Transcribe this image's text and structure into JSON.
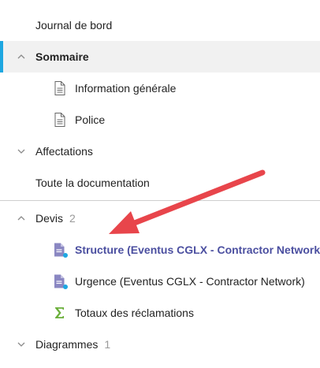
{
  "tree": {
    "journal": {
      "label": "Journal de bord"
    },
    "sommaire": {
      "label": "Sommaire",
      "children": {
        "info": {
          "label": "Information générale"
        },
        "police": {
          "label": "Police"
        }
      }
    },
    "affectations": {
      "label": "Affectations"
    },
    "documentation": {
      "label": "Toute la documentation"
    },
    "devis": {
      "label": "Devis",
      "count": "2",
      "children": {
        "structure": {
          "label": "Structure (Eventus CGLX - Contractor Network)"
        },
        "urgence": {
          "label": "Urgence (Eventus CGLX - Contractor Network)"
        },
        "totaux": {
          "label": "Totaux des réclamations"
        }
      }
    },
    "diagrammes": {
      "label": "Diagrammes",
      "count": "1"
    }
  },
  "colors": {
    "accent": "#1ea7e1",
    "active_link": "#4b4fa0",
    "doc_icon_fill": "#8a87c2",
    "status_dot": "#1ea7e1",
    "sigma": "#6aaf3a",
    "arrow": "#e8454b"
  }
}
